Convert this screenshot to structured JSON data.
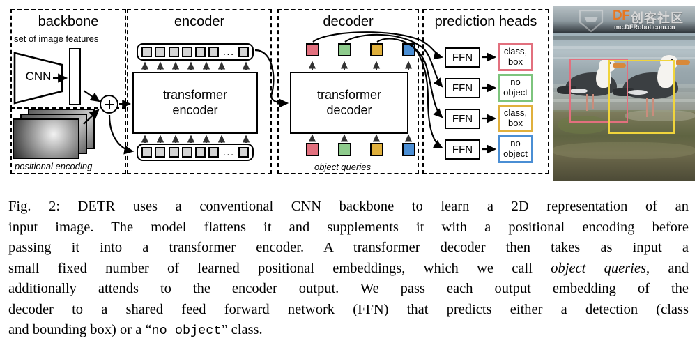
{
  "figure": {
    "sections": [
      {
        "id": "backbone",
        "title": "backbone"
      },
      {
        "id": "encoder",
        "title": "encoder"
      },
      {
        "id": "decoder",
        "title": "decoder"
      },
      {
        "id": "prediction_heads",
        "title": "prediction heads"
      }
    ],
    "backbone": {
      "feature_label": "set of image features",
      "cnn_label": "CNN",
      "positional_label": "positional encoding",
      "plus_symbol": "+"
    },
    "encoder": {
      "box_line1": "transformer",
      "box_line2": "encoder",
      "token_ellipsis": "...",
      "token_count": 7
    },
    "decoder": {
      "box_line1": "transformer",
      "box_line2": "decoder",
      "queries_label": "object queries",
      "query_colors": [
        "#e2707e",
        "#8ecb8c",
        "#e0b03c",
        "#4a8ed4"
      ]
    },
    "prediction_heads": {
      "ffn_label": "FFN",
      "heads": [
        {
          "ffn": "FFN",
          "result_line1": "class,",
          "result_line2": "box",
          "color": "#e2707e"
        },
        {
          "ffn": "FFN",
          "result_line1": "no",
          "result_line2": "object",
          "color": "#7dc47d"
        },
        {
          "ffn": "FFN",
          "result_line1": "class,",
          "result_line2": "box",
          "color": "#e0b03c"
        },
        {
          "ffn": "FFN",
          "result_line1": "no",
          "result_line2": "object",
          "color": "#4a8ed4"
        }
      ]
    },
    "photo": {
      "watermark_brand": "DF",
      "watermark_cn": "创客社区",
      "watermark_url": "mc.DFRobot.com.cn",
      "bbox_colors": [
        "#e2707e",
        "#f0d43c"
      ]
    }
  },
  "caption": {
    "lines": [
      {
        "segments": [
          {
            "t": "Fig. 2: DETR uses a conventional CNN backbone to learn a 2D representation of an",
            "s": "r"
          }
        ]
      },
      {
        "segments": [
          {
            "t": "input image. The model flattens it and supplements it with a positional encoding before",
            "s": "r"
          }
        ]
      },
      {
        "segments": [
          {
            "t": "passing it into a transformer encoder. A transformer decoder then takes as input a",
            "s": "r"
          }
        ]
      },
      {
        "segments": [
          {
            "t": "small fixed number of learned positional embeddings, which we call ",
            "s": "r"
          },
          {
            "t": "object queries",
            "s": "i"
          },
          {
            "t": ", and",
            "s": "r"
          }
        ]
      },
      {
        "segments": [
          {
            "t": "additionally attends to the encoder output. We pass each output embedding of the",
            "s": "r"
          }
        ]
      },
      {
        "segments": [
          {
            "t": "decoder to a shared feed forward network (FFN) that predicts either a detection (class",
            "s": "r"
          }
        ]
      },
      {
        "segments": [
          {
            "t": "and bounding box) or a “",
            "s": "r"
          },
          {
            "t": "no object",
            "s": "m"
          },
          {
            "t": "” class.",
            "s": "r"
          }
        ]
      }
    ]
  }
}
